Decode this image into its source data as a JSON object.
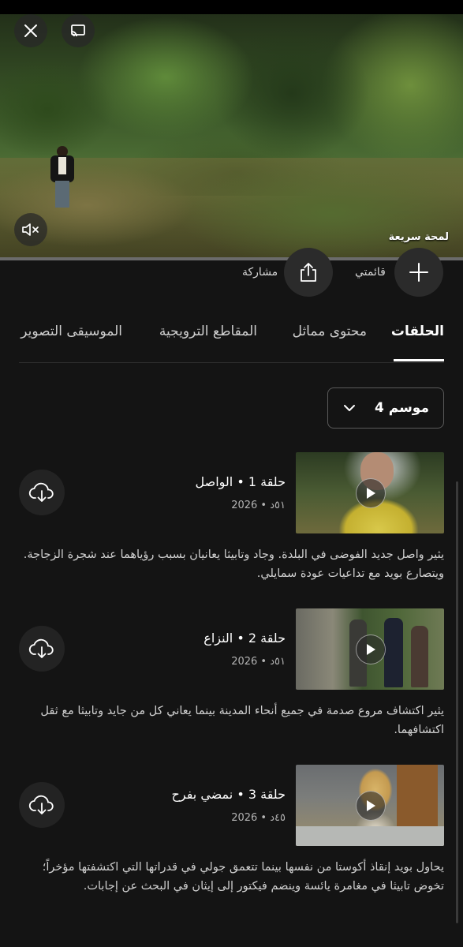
{
  "player": {
    "quick_look_label": "لمحة سريعة",
    "close_icon": "close-icon",
    "cast_icon": "cast-icon",
    "mute_icon": "volume-muted-icon"
  },
  "actions": {
    "my_list_label": "قائمتي",
    "share_label": "مشاركة"
  },
  "tabs": [
    {
      "label": "الحلقات",
      "active": true
    },
    {
      "label": "محتوى مماثل",
      "active": false
    },
    {
      "label": "المقاطع الترويجية",
      "active": false
    },
    {
      "label": "الموسيقى التصوير",
      "active": false
    }
  ],
  "season_selector": {
    "label": "موسم 4"
  },
  "episodes": [
    {
      "title": "حلقة 1 • الواصل",
      "meta": "٥١د • 2026",
      "description": "يثير واصل جديد الفوضى في البلدة. وجاد وتابيثا يعانيان بسبب رؤياهما عند شجرة الزجاجة. ويتصارع بويد مع تداعيات عودة سمايلي."
    },
    {
      "title": "حلقة 2 • النزاع",
      "meta": "٥١د • 2026",
      "description": "يثير اكتشاف مروع صدمة في جميع أنحاء المدينة بينما يعاني كل من جايد وتابيثا مع ثقل اكتشافهما."
    },
    {
      "title": "حلقة 3 • نمضي بفرح",
      "meta": "٤٥د • 2026",
      "description": "يحاول بويد إنقاذ أكوستا من نفسها بينما تتعمق جولي في قدراتها التي اكتشفتها مؤخراً؛ تخوض تابيثا في مغامرة يائسة وينضم فيكتور إلى إيثان في البحث عن إجابات."
    }
  ],
  "colors": {
    "background": "#141414",
    "button_bg": "#2b2b2b",
    "text_secondary": "#b3b3b3"
  }
}
